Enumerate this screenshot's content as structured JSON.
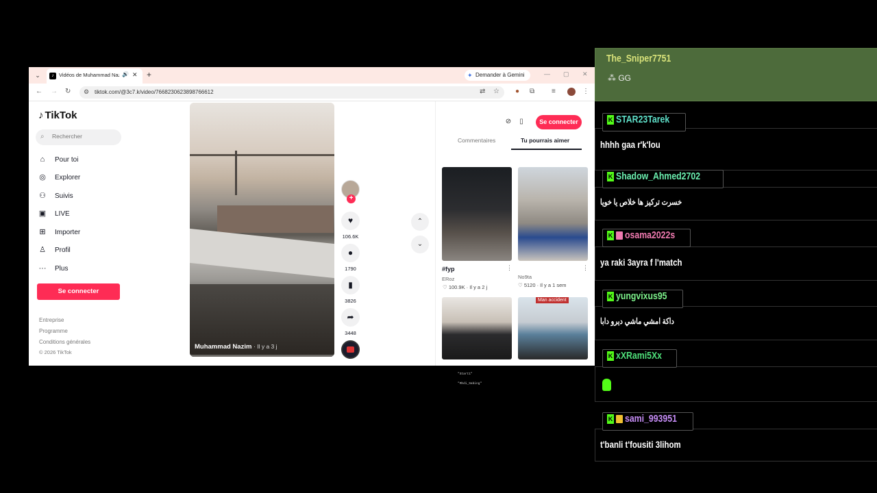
{
  "browser": {
    "tab_title": "Vidéos de Muhammad Nazim",
    "gemini_label": "Demander à Gemini",
    "url": "tiktok.com/@3c7.k/video/7668230623898766612"
  },
  "sidebar": {
    "logo": "TikTok",
    "search_placeholder": "Rechercher",
    "items": [
      {
        "label": "Pour toi",
        "icon": "home-icon"
      },
      {
        "label": "Explorer",
        "icon": "compass-icon"
      },
      {
        "label": "Suivis",
        "icon": "following-icon"
      },
      {
        "label": "LIVE",
        "icon": "live-icon"
      },
      {
        "label": "Importer",
        "icon": "upload-icon"
      },
      {
        "label": "Profil",
        "icon": "profile-icon"
      },
      {
        "label": "Plus",
        "icon": "more-icon"
      }
    ],
    "login_label": "Se connecter",
    "footer": [
      "Entreprise",
      "Programme",
      "Conditions générales",
      "© 2026 TikTok"
    ]
  },
  "video": {
    "author": "Muhammad Nazim",
    "time": "· Il y a 3 j",
    "progress": 0.0,
    "likes": "106.6K",
    "comments": "1790",
    "saves": "3826",
    "shares": "3448"
  },
  "right_panel": {
    "login_label": "Se connecter",
    "tabs": [
      "Commentaires",
      "Tu pourrais aimer"
    ],
    "active_tab": "Tu pourrais aimer",
    "cards": [
      {
        "title": "#fyp",
        "author": "ERoz",
        "likes": "100.9K",
        "age": "Il y a 2 j"
      },
      {
        "title": "",
        "author": "No9ta",
        "likes": "5120",
        "age": "Il y a 1 sem"
      },
      {
        "title": "",
        "author": "",
        "likes": "",
        "age": ""
      },
      {
        "title": "",
        "author": "",
        "likes": "",
        "age": "",
        "overlay": "Man accident"
      }
    ]
  },
  "terminal": {
    "lines": [
      "\"Start1\"",
      "\"Mhdi_Sabing\""
    ]
  },
  "chat": {
    "accent": "#53fc18",
    "messages": [
      {
        "user": "The_Sniper7751",
        "text": "GG",
        "color": "#d8e27a"
      },
      {
        "user": "STAR23Tarek",
        "text": "hhhh gaa r'k'lou",
        "color": "#5fe0c9"
      },
      {
        "user": "Shadow_Ahmed2702",
        "text": "خسرت تركيز ها خلاص يا خويا",
        "color": "#6cf0b0"
      },
      {
        "user": "osama2022s",
        "text": "ya raki 3ayra f l'match",
        "color": "#f07ab0"
      },
      {
        "user": "yungvixus95",
        "text": "داكة امشي ماشي ديرو دابا",
        "color": "#7cf08a"
      },
      {
        "user": "xXRami5Xx",
        "text": "",
        "color": "#4fe07a"
      },
      {
        "user": "sami_993951",
        "text": "t'banli t'fousiti 3lihom",
        "color": "#c58cf5"
      }
    ]
  }
}
